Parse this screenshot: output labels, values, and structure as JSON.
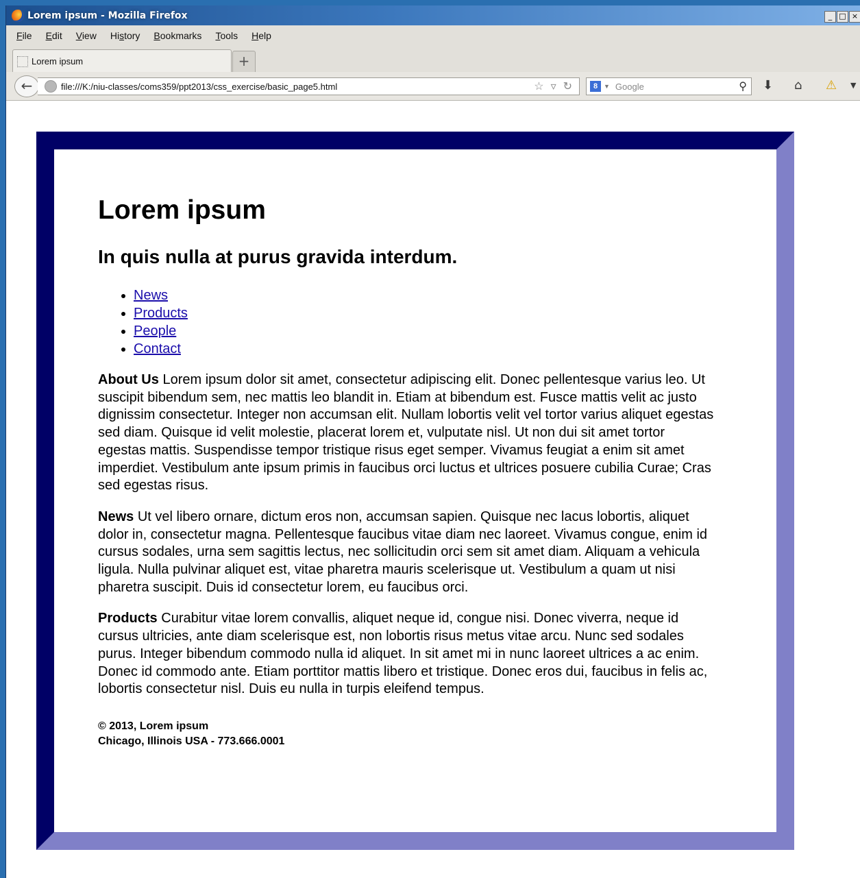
{
  "window": {
    "title": "Lorem ipsum - Mozilla Firefox",
    "controls": {
      "minimize": "_",
      "maximize": "□",
      "close": "×"
    }
  },
  "menubar": {
    "items": [
      {
        "label": "File",
        "hotkey": "F",
        "rest": "ile"
      },
      {
        "label": "Edit",
        "hotkey": "E",
        "rest": "dit"
      },
      {
        "label": "View",
        "hotkey": "V",
        "rest": "iew"
      },
      {
        "label": "History",
        "hotkey": "s",
        "pre": "Hi",
        "rest": "tory"
      },
      {
        "label": "Bookmarks",
        "hotkey": "B",
        "rest": "ookmarks"
      },
      {
        "label": "Tools",
        "hotkey": "T",
        "rest": "ools"
      },
      {
        "label": "Help",
        "hotkey": "H",
        "rest": "elp"
      }
    ]
  },
  "tabs": [
    {
      "label": "Lorem ipsum"
    }
  ],
  "newtab": {
    "label": "+"
  },
  "navbar": {
    "back_icon": "back-arrow-icon",
    "url": "file:///K:/niu-classes/coms359/ppt2013/css_exercise/basic_page5.html",
    "search_placeholder": "Google",
    "search_engine_badge": "8"
  },
  "page": {
    "heading": "Lorem ipsum",
    "subheading": "In quis nulla at purus gravida interdum.",
    "nav_links": [
      "News",
      "Products",
      "People",
      "Contact"
    ],
    "sections": [
      {
        "label": "About Us",
        "text": "Lorem ipsum dolor sit amet, consectetur adipiscing elit. Donec pellentesque varius leo. Ut suscipit bibendum sem, nec mattis leo blandit in. Etiam at bibendum est. Fusce mattis velit ac justo dignissim consectetur. Integer non accumsan elit. Nullam lobortis velit vel tortor varius aliquet egestas sed diam. Quisque id velit molestie, placerat lorem et, vulputate nisl. Ut non dui sit amet tortor egestas mattis. Suspendisse tempor tristique risus eget semper. Vivamus feugiat a enim sit amet imperdiet. Vestibulum ante ipsum primis in faucibus orci luctus et ultrices posuere cubilia Curae; Cras sed egestas risus."
      },
      {
        "label": "News",
        "text": "Ut vel libero ornare, dictum eros non, accumsan sapien. Quisque nec lacus lobortis, aliquet dolor in, consectetur magna. Pellentesque faucibus vitae diam nec laoreet. Vivamus congue, enim id cursus sodales, urna sem sagittis lectus, nec sollicitudin orci sem sit amet diam. Aliquam a vehicula ligula. Nulla pulvinar aliquet est, vitae pharetra mauris scelerisque ut. Vestibulum a quam ut nisi pharetra suscipit. Duis id consectetur lorem, eu faucibus orci."
      },
      {
        "label": "Products",
        "text": "Curabitur vitae lorem convallis, aliquet neque id, congue nisi. Donec viverra, neque id cursus ultricies, ante diam scelerisque est, non lobortis risus metus vitae arcu. Nunc sed sodales purus. Integer bibendum commodo nulla id aliquet. In sit amet mi in nunc laoreet ultrices a ac enim. Donec id commodo ante. Etiam porttitor mattis libero et tristique. Donec eros dui, faucibus in felis ac, lobortis consectetur nisl. Duis eu nulla in turpis eleifend tempus."
      }
    ],
    "footer": {
      "line1": "© 2013, Lorem ipsum",
      "line2": "Chicago, Illinois USA - 773.666.0001"
    }
  },
  "colors": {
    "border_dark": "#000066",
    "border_light": "#8080c8",
    "link": "#1a0dab"
  }
}
